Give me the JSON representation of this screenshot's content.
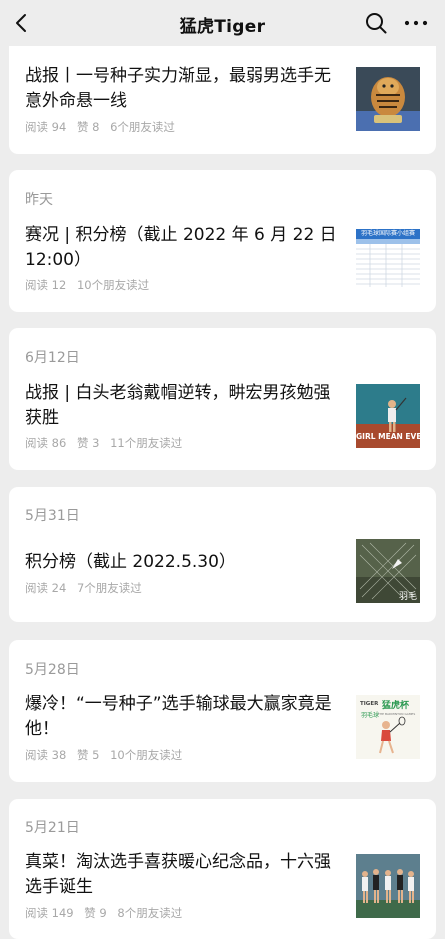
{
  "nav": {
    "title": "猛虎Tiger"
  },
  "articles": [
    {
      "date": "",
      "title": "战报丨一号种子实力渐显，最弱男选手无意外命悬一线",
      "reads": "阅读 94",
      "likes": "赞 8",
      "friends": "6个朋友读过",
      "thumb_icon": "tiger-figurine-thumbnail"
    },
    {
      "date": "昨天",
      "title": "赛况 | 积分榜（截止 2022 年 6 月 22 日 12:00）",
      "reads": "阅读 12",
      "likes": "",
      "friends": "10个朋友读过",
      "thumb_icon": "leaderboard-table-thumbnail",
      "thumb_header": "羽毛球国际赛小组赛"
    },
    {
      "date": "6月12日",
      "title": "战报 | 白头老翁戴帽逆转，畊宏男孩勉强获胜",
      "reads": "阅读 86",
      "likes": "赞 3",
      "friends": "11个朋友读过",
      "thumb_icon": "badminton-court-thumbnail",
      "thumb_text": "GIRL MEAN EVER"
    },
    {
      "date": "5月31日",
      "title": "积分榜（截止 2022.5.30）",
      "reads": "阅读 24",
      "likes": "",
      "friends": "7个朋友读过",
      "thumb_icon": "badminton-net-thumbnail",
      "thumb_text": "羽毛"
    },
    {
      "date": "5月28日",
      "title": "爆冷！“一号种子”选手输球最大赢家竟是他！",
      "reads": "阅读 38",
      "likes": "赞 5",
      "friends": "10个朋友读过",
      "thumb_icon": "tiger-badminton-poster-thumbnail",
      "thumb_brand": "TIGER",
      "thumb_cup": "猛虎杯",
      "thumb_sub": "羽毛球",
      "thumb_tag": "THE BADMINTON GAMES"
    },
    {
      "date": "5月21日",
      "title": "真菜！淘汰选手喜获暖心纪念品，十六强选手诞生",
      "reads": "阅读 149",
      "likes": "赞 9",
      "friends": "8个朋友读过",
      "thumb_icon": "group-photo-thumbnail"
    }
  ]
}
